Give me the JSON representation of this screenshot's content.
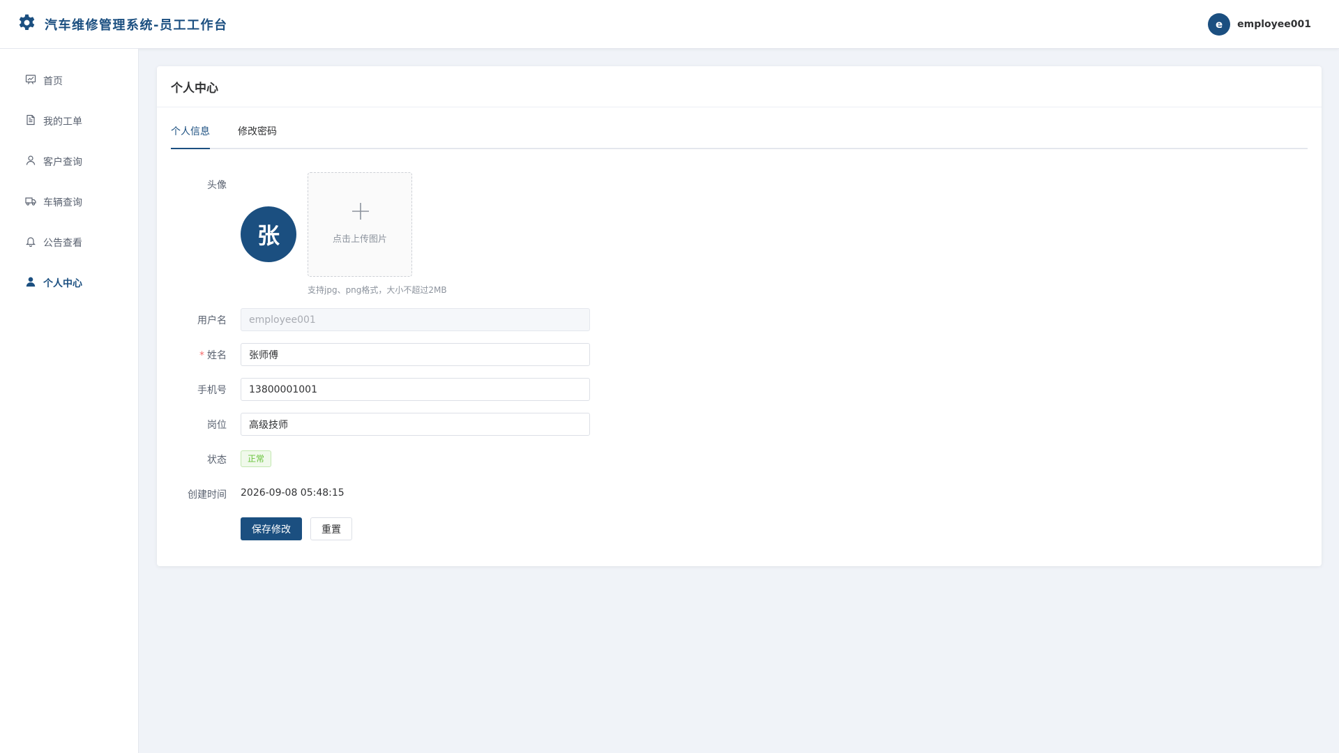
{
  "header": {
    "app_title": "汽车维修管理系统-员工工作台",
    "logo_icon": "gear-icon",
    "user_initial": "e",
    "username": "employee001"
  },
  "sidebar": {
    "items": [
      {
        "label": "首页",
        "icon": "dashboard-chart-icon",
        "active": false
      },
      {
        "label": "我的工单",
        "icon": "document-icon",
        "active": false
      },
      {
        "label": "客户查询",
        "icon": "user-outline-icon",
        "active": false
      },
      {
        "label": "车辆查询",
        "icon": "truck-icon",
        "active": false
      },
      {
        "label": "公告查看",
        "icon": "bell-icon",
        "active": false
      },
      {
        "label": "个人中心",
        "icon": "user-filled-icon",
        "active": true
      }
    ]
  },
  "card": {
    "title": "个人中心",
    "tabs": [
      {
        "label": "个人信息",
        "active": true
      },
      {
        "label": "修改密码",
        "active": false
      }
    ]
  },
  "form": {
    "avatar": {
      "label": "头像",
      "initial": "张",
      "upload_text": "点击上传图片",
      "hint": "支持jpg、png格式，大小不超过2MB"
    },
    "username": {
      "label": "用户名",
      "value": "employee001",
      "disabled": true
    },
    "name": {
      "label": "姓名",
      "required_mark": "*",
      "value": "张师傅"
    },
    "phone": {
      "label": "手机号",
      "value": "13800001001"
    },
    "position": {
      "label": "岗位",
      "value": "高级技师"
    },
    "status": {
      "label": "状态",
      "value": "正常"
    },
    "created": {
      "label": "创建时间",
      "value": "2026-09-08 05:48:15"
    }
  },
  "actions": {
    "save_label": "保存修改",
    "reset_label": "重置"
  },
  "colors": {
    "primary": "#1b4f80",
    "background": "#f0f3f8",
    "status_success": "#67c23a",
    "required": "#f56c6c"
  }
}
